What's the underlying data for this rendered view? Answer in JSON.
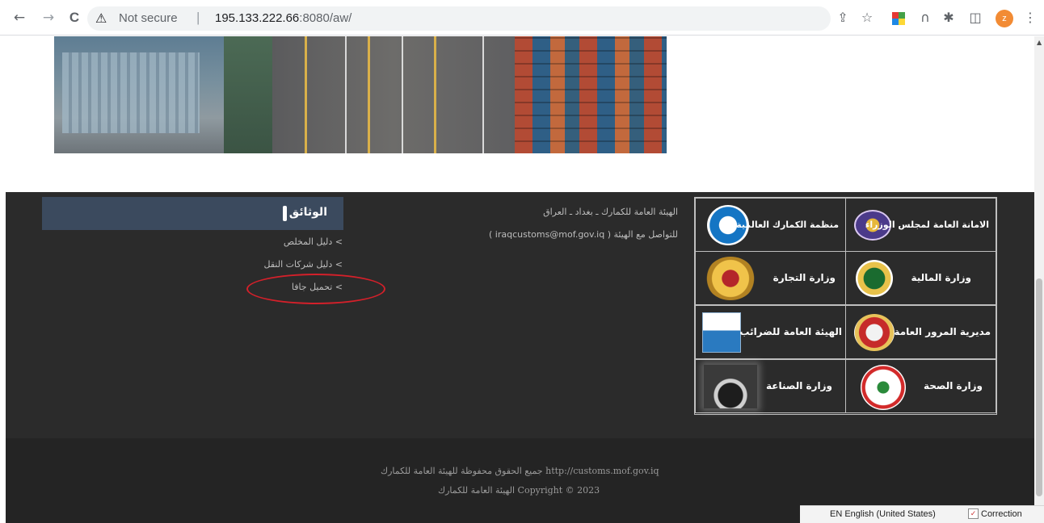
{
  "browser": {
    "back_icon": "←",
    "forward_icon": "→",
    "reload_icon": "C",
    "security_label": "Not secure",
    "url_host": "195.133.222.66",
    "url_rest": ":8080/aw/",
    "avatar_letter": "z"
  },
  "docs": {
    "title": "الوثائق",
    "links": [
      "> دليل المخلص",
      "> دليل شركات النقل",
      "> تحميل جافا"
    ]
  },
  "contact": {
    "address": "الهيئة العامة للكمارك ـ بغداد ـ العراق",
    "email_line": "للتواصل مع الهيئة ( iraqcustoms@mof.gov.iq )"
  },
  "partners": [
    {
      "label": "الامانة العامة لمجلس الوزراء"
    },
    {
      "label": "منظمة الكمارك العالمية"
    },
    {
      "label": "وزارة المالية"
    },
    {
      "label": "وزارة التجارة"
    },
    {
      "label": "مديرية المرور العامة"
    },
    {
      "label": "الهيئة العامة للضرائب"
    },
    {
      "label": "وزارة الصحة"
    },
    {
      "label": "وزارة الصناعة"
    }
  ],
  "footer": {
    "line1": "جميع الحقوق محفوظة للهيئة العامة للكمارك http://customs.mof.gov.iq",
    "line2": "الهيئة العامة للكمارك Copyright © 2023"
  },
  "language_bar": {
    "language": "EN English (United States)",
    "correction": "Correction"
  },
  "colors": {
    "footer_bg": "#2b2b2b",
    "docs_header_bg": "#3b4a5e",
    "highlight": "#d4202a"
  }
}
